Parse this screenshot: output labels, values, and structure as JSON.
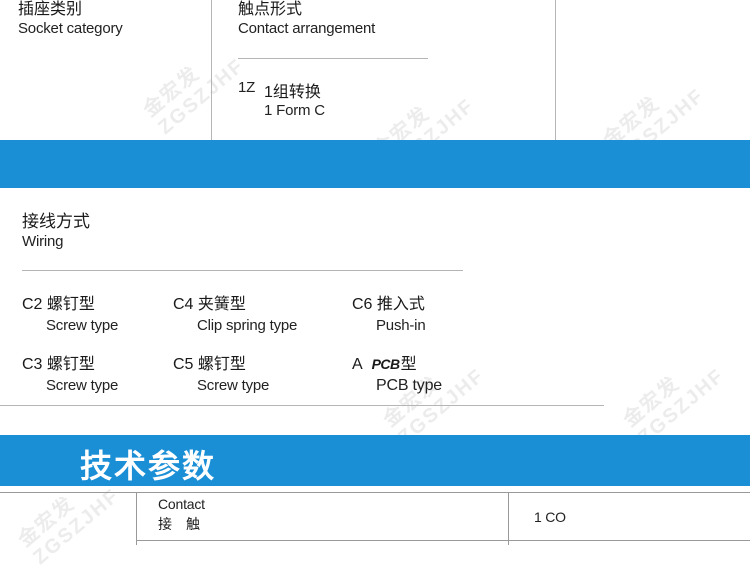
{
  "top": {
    "socket_zh": "插座类别",
    "socket_en": "Socket category",
    "contact_zh": "触点形式",
    "contact_en": "Contact arrangement",
    "form_code": "1Z",
    "form_zh": "1组转换",
    "form_en": "1 Form C"
  },
  "wiring": {
    "title_zh": "接线方式",
    "title_en": "Wiring",
    "items": [
      {
        "code": "C2",
        "zh": "螺钉型",
        "en": "Screw type"
      },
      {
        "code": "C4",
        "zh": "夹簧型",
        "en": "Clip spring type"
      },
      {
        "code": "C6",
        "zh": "推入式",
        "en": "Push-in"
      },
      {
        "code": "C3",
        "zh": "螺钉型",
        "en": "Screw type"
      },
      {
        "code": "C5",
        "zh": "螺钉型",
        "en": "Screw type"
      },
      {
        "code": "A",
        "zh": "型",
        "en": "PCB type",
        "logo": "PCB"
      }
    ]
  },
  "tech": {
    "title": "技术参数",
    "row1_label_en": "Contact",
    "row1_label_zh": "接　触",
    "row1_value": "1 CO"
  },
  "watermark": {
    "line1": "金宏发",
    "line2": "ZGSZJHF"
  },
  "colors": {
    "band": "#1a8fd6",
    "rule": "#b5b5b5"
  }
}
